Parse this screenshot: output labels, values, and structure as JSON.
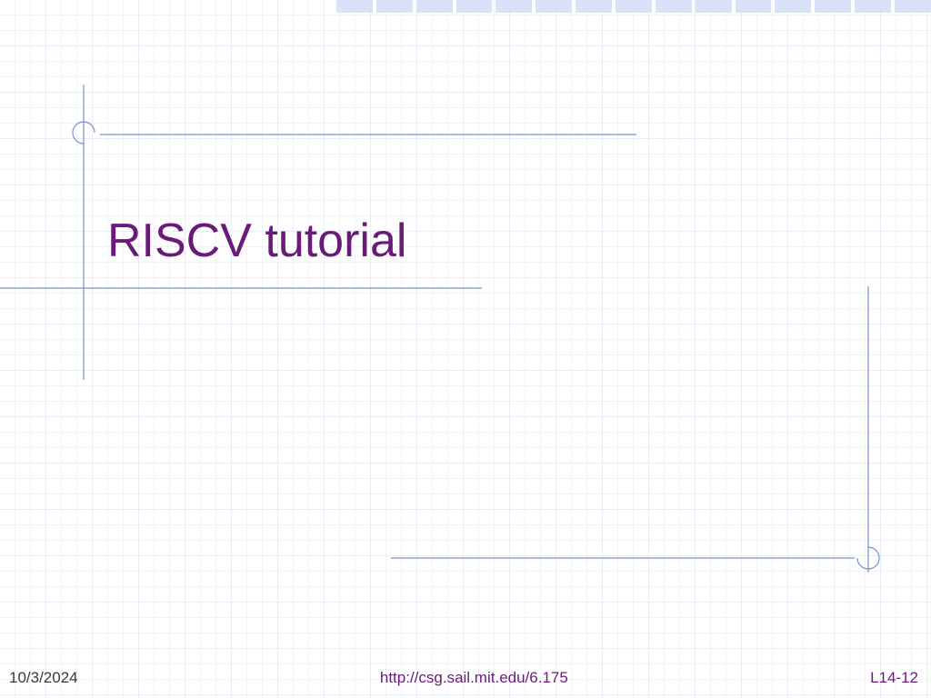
{
  "slide": {
    "title": "RISCV tutorial"
  },
  "footer": {
    "date": "10/3/2024",
    "url": "http://csg.sail.mit.edu/6.175",
    "page": "L14-12"
  }
}
